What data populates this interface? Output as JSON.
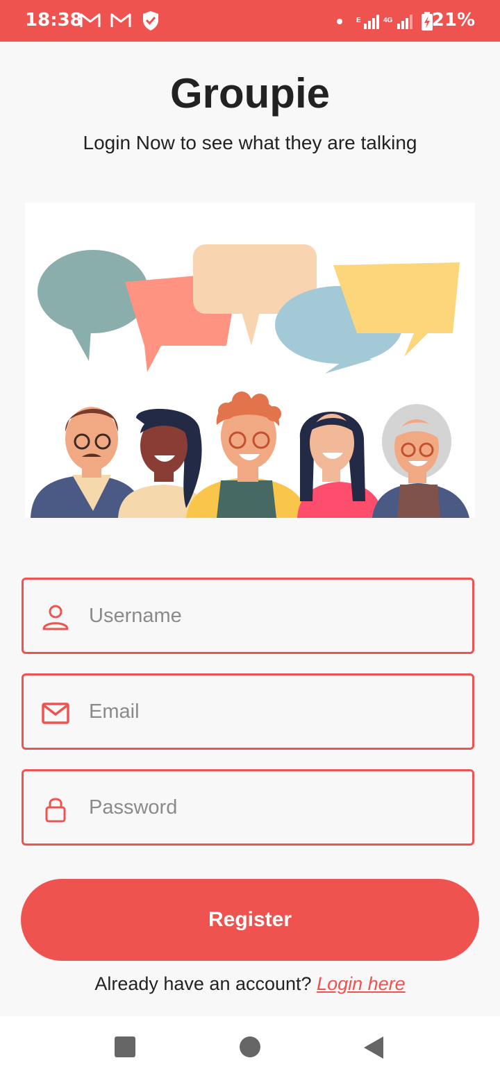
{
  "status_bar": {
    "time": "18:38",
    "battery_percent": "21%",
    "network_label_1": "E",
    "network_label_2": "4G"
  },
  "header": {
    "title": "Groupie",
    "subtitle": "Login Now to see what they are talking"
  },
  "form": {
    "username_placeholder": "Username",
    "email_placeholder": "Email",
    "password_placeholder": "Password",
    "register_label": "Register"
  },
  "footer": {
    "prompt": "Already have an account? ",
    "login_link": "Login here"
  },
  "colors": {
    "accent": "#ef5350",
    "background": "#f9f8f8"
  }
}
